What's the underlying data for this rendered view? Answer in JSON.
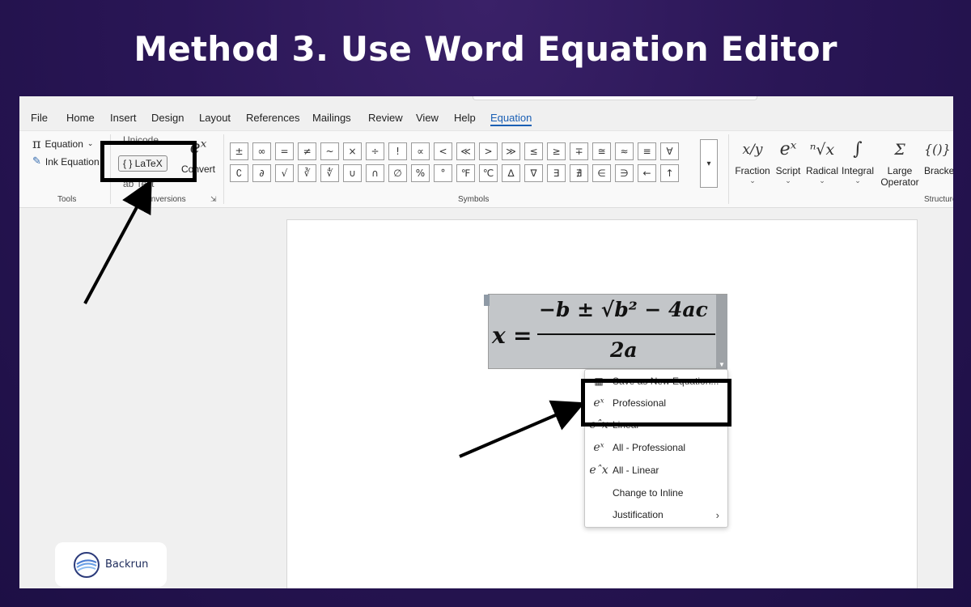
{
  "headline": "Method 3. Use Word Equation Editor",
  "menu": [
    "File",
    "Home",
    "Insert",
    "Design",
    "Layout",
    "References",
    "Mailings",
    "Review",
    "View",
    "Help",
    "Equation"
  ],
  "active_menu": "Equation",
  "tools": {
    "equation_label": "Equation",
    "ink_label": "Ink Equation",
    "group_label": "Tools"
  },
  "conversions": {
    "unicode_label": "Unicode",
    "latex_label": "{ } LaTeX",
    "text_label": "ab Text",
    "convert_label": "Convert",
    "group_label": "Conversions"
  },
  "symbols": {
    "row1": [
      "±",
      "∞",
      "=",
      "≠",
      "~",
      "×",
      "÷",
      "!",
      "∝",
      "<",
      "≪",
      ">",
      "≫",
      "≤",
      "≥",
      "∓",
      "≅",
      "≈",
      "≡",
      "∀"
    ],
    "row2": [
      "∁",
      "∂",
      "√",
      "∛",
      "∜",
      "∪",
      "∩",
      "∅",
      "%",
      "°",
      "℉",
      "℃",
      "∆",
      "∇",
      "∃",
      "∄",
      "∈",
      "∋",
      "←",
      "↑"
    ],
    "group_label": "Symbols"
  },
  "structures": {
    "items": [
      {
        "icon": "x/y",
        "label": "Fraction"
      },
      {
        "icon": "eˣ",
        "label": "Script"
      },
      {
        "icon": "ⁿ√x",
        "label": "Radical"
      },
      {
        "icon": "∫",
        "label": "Integral"
      },
      {
        "icon": "Σ",
        "label": "Large Operator"
      },
      {
        "icon": "{()}",
        "label": "Bracket"
      }
    ],
    "group_label": "Structures"
  },
  "equation": {
    "lhs": "x",
    "equals": "=",
    "numerator": "−b ± √b² − 4ac",
    "denominator": "2a"
  },
  "context_menu": [
    {
      "icon": "▦",
      "label": "Save as New Equation..."
    },
    {
      "icon": "eˣ",
      "label": "Professional"
    },
    {
      "icon": "eˆx",
      "label": "Linear"
    },
    {
      "icon": "eˣ",
      "label": "All - Professional"
    },
    {
      "icon": "eˆx",
      "label": "All - Linear"
    },
    {
      "icon": "",
      "label": "Change to Inline"
    },
    {
      "icon": "",
      "label": "Justification"
    }
  ],
  "logo": "Backrun"
}
